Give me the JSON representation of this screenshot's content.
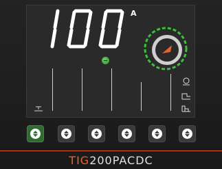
{
  "display": {
    "value": "100",
    "unit": "A"
  },
  "buttons": [
    {
      "name": "button-1",
      "active": true
    },
    {
      "name": "button-2",
      "active": false
    },
    {
      "name": "button-3",
      "active": false
    },
    {
      "name": "button-4",
      "active": false
    },
    {
      "name": "button-5",
      "active": false
    },
    {
      "name": "button-6",
      "active": false
    }
  ],
  "brand": {
    "prefix": "TIG",
    "suffix": "200PACDC"
  },
  "colors": {
    "accent": "#e8642f",
    "dial_ring": "#3fbf3f",
    "active_button": "#2f6b2f"
  },
  "icons": {
    "dial": "orange-knob-icon",
    "side_top": "arc-ignition-icon",
    "side_mid": "pulse-wave-icon",
    "side_bottom": "square-wave-icon",
    "bottom_left": "torch-icon"
  }
}
